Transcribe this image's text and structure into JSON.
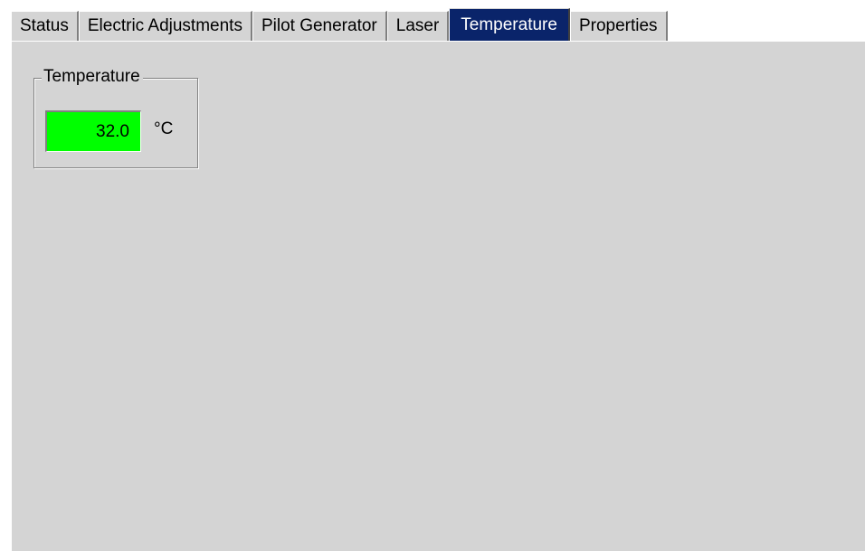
{
  "tabs": [
    {
      "label": "Status",
      "active": false
    },
    {
      "label": "Electric Adjustments",
      "active": false
    },
    {
      "label": "Pilot Generator",
      "active": false
    },
    {
      "label": "Laser",
      "active": false
    },
    {
      "label": "Temperature",
      "active": true
    },
    {
      "label": "Properties",
      "active": false
    }
  ],
  "temperature_group": {
    "title": "Temperature",
    "value": "32.0",
    "unit": "°C",
    "value_background": "#00ff00"
  },
  "colors": {
    "active_tab": "#0a246a",
    "panel": "#d4d4d4"
  }
}
